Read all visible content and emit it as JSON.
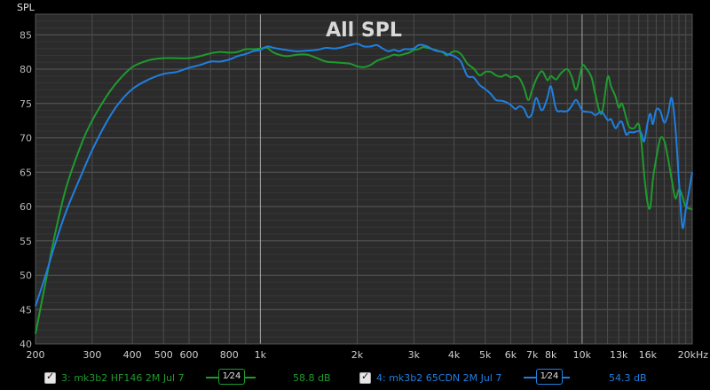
{
  "chart_data": {
    "type": "line",
    "title": "All SPL",
    "ylabel": "SPL",
    "xunit": "Hz",
    "xscale": "log",
    "xlim": [
      200,
      22000
    ],
    "ylim": [
      40,
      88
    ],
    "grid": true,
    "ytick_labels": [
      "40",
      "45",
      "50",
      "55",
      "60",
      "65",
      "70",
      "75",
      "80",
      "85"
    ],
    "yticks": [
      40,
      45,
      50,
      55,
      60,
      65,
      70,
      75,
      80,
      85
    ],
    "xticks": [
      200,
      300,
      400,
      500,
      600,
      800,
      1000,
      2000,
      3000,
      4000,
      5000,
      6000,
      7000,
      8000,
      10000,
      13000,
      16000,
      20000
    ],
    "xtick_labels": [
      "200",
      "300",
      "400",
      "500",
      "600",
      "800",
      "1k",
      "2k",
      "3k",
      "4k",
      "5k",
      "6k",
      "7k",
      "8k",
      "10k",
      "13k",
      "16k",
      "20kHz"
    ],
    "series": [
      {
        "name": "3: mk3b2 HF146 2M Jul 7",
        "color": "#1f9a2e",
        "x": [
          200,
          215,
          230,
          250,
          280,
          300,
          330,
          360,
          400,
          450,
          500,
          550,
          600,
          650,
          700,
          750,
          800,
          850,
          900,
          950,
          1000,
          1050,
          1100,
          1200,
          1300,
          1400,
          1500,
          1600,
          1700,
          1800,
          1900,
          2000,
          2100,
          2200,
          2300,
          2400,
          2500,
          2600,
          2700,
          2800,
          2900,
          3000,
          3100,
          3200,
          3300,
          3500,
          3700,
          3800,
          4000,
          4200,
          4400,
          4600,
          4800,
          5000,
          5200,
          5400,
          5600,
          5800,
          6000,
          6200,
          6400,
          6600,
          6800,
          7000,
          7200,
          7500,
          7800,
          8000,
          8300,
          8600,
          9000,
          9300,
          9600,
          10000,
          10300,
          10700,
          11000,
          11500,
          12000,
          12300,
          12700,
          13000,
          13300,
          13700,
          14000,
          14500,
          15000,
          15300,
          15600,
          16000,
          16300,
          16600,
          17000,
          17500,
          18000,
          18500,
          19000,
          19500,
          20000,
          20500,
          21000,
          22000
        ],
        "y": [
          41.5,
          49,
          56,
          63,
          69.5,
          72.5,
          75.8,
          78.2,
          80.3,
          81.3,
          81.6,
          81.6,
          81.6,
          81.9,
          82.3,
          82.5,
          82.4,
          82.5,
          82.9,
          82.9,
          83,
          83.1,
          82.4,
          81.9,
          82.1,
          82.1,
          81.6,
          81.1,
          81,
          80.9,
          80.8,
          80.4,
          80.3,
          80.6,
          81.2,
          81.5,
          81.8,
          82.1,
          82,
          82.2,
          82.4,
          82.8,
          82.9,
          83.2,
          83.1,
          82.8,
          82.4,
          82,
          82.6,
          82.2,
          80.8,
          80.1,
          79.1,
          79.6,
          79.6,
          79.1,
          78.9,
          79.2,
          78.8,
          79,
          78.6,
          77.3,
          75.5,
          77,
          78.5,
          79.7,
          78.4,
          79,
          78.5,
          79.4,
          80,
          78.8,
          77,
          80.4,
          80.1,
          78.8,
          76.3,
          73.5,
          78.8,
          77.5,
          76,
          74.4,
          75,
          73,
          71.6,
          71.4,
          72,
          69.2,
          64.6,
          60.4,
          60,
          63.9,
          67,
          69.9,
          69.6,
          67,
          63.9,
          61.2,
          62.5,
          61.5,
          60,
          59.6
        ]
      },
      {
        "name": "4: mk3b2 65CDN 2M Jul 7",
        "color": "#1f7fe0",
        "x": [
          200,
          215,
          230,
          250,
          280,
          300,
          330,
          360,
          400,
          450,
          500,
          550,
          600,
          650,
          700,
          750,
          800,
          850,
          900,
          950,
          1000,
          1050,
          1100,
          1200,
          1300,
          1400,
          1500,
          1600,
          1700,
          1800,
          1900,
          2000,
          2100,
          2200,
          2300,
          2400,
          2500,
          2600,
          2700,
          2800,
          2900,
          3000,
          3100,
          3200,
          3300,
          3500,
          3700,
          3800,
          4000,
          4200,
          4400,
          4600,
          4800,
          5000,
          5200,
          5400,
          5600,
          5800,
          6000,
          6200,
          6400,
          6600,
          6800,
          7000,
          7200,
          7500,
          7800,
          8000,
          8300,
          8600,
          9000,
          9300,
          9600,
          10000,
          10300,
          10700,
          11000,
          11500,
          12000,
          12300,
          12700,
          13000,
          13300,
          13700,
          14000,
          14500,
          15000,
          15300,
          15600,
          16000,
          16300,
          16600,
          17000,
          17500,
          18000,
          18500,
          19000,
          19500,
          20000,
          20500,
          21000,
          22000
        ],
        "y": [
          45.5,
          50,
          54.5,
          59.5,
          65,
          68.2,
          72,
          74.8,
          77.1,
          78.5,
          79.3,
          79.6,
          80.2,
          80.6,
          81.1,
          81.1,
          81.4,
          81.9,
          82.2,
          82.6,
          82.8,
          83.3,
          83.1,
          82.8,
          82.6,
          82.7,
          82.8,
          83.1,
          83,
          83.2,
          83.5,
          83.7,
          83.3,
          83.3,
          83.5,
          83,
          82.6,
          82.8,
          82.6,
          82.9,
          82.9,
          83,
          83.5,
          83.5,
          83.3,
          82.7,
          82.5,
          82.2,
          81.9,
          81.1,
          79,
          78.8,
          77.7,
          77.1,
          76.4,
          75.5,
          75.4,
          75.2,
          74.8,
          74.2,
          74.6,
          74.2,
          73,
          73.6,
          75.8,
          74,
          75.8,
          77.5,
          74.2,
          73.9,
          73.9,
          74.7,
          75.5,
          74,
          73.8,
          73.7,
          73.3,
          73.8,
          72.6,
          72.7,
          71.4,
          72.1,
          72.3,
          70.5,
          70.8,
          70.8,
          71,
          70.6,
          69.5,
          72.3,
          73.5,
          72,
          74.1,
          73.9,
          72.2,
          73.5,
          75.8,
          71.5,
          63.8,
          57,
          59.5,
          65
        ]
      }
    ]
  },
  "legend": {
    "items": [
      {
        "label": "3: mk3b2 HF146 2M Jul 7",
        "smoothing": "1⁄24",
        "level": "58.8 dB",
        "color": "#1f9a2e"
      },
      {
        "label": "4: mk3b2 65CDN 2M Jul 7",
        "smoothing": "1⁄24",
        "level": "54.3 dB",
        "color": "#1f7fe0"
      }
    ]
  }
}
